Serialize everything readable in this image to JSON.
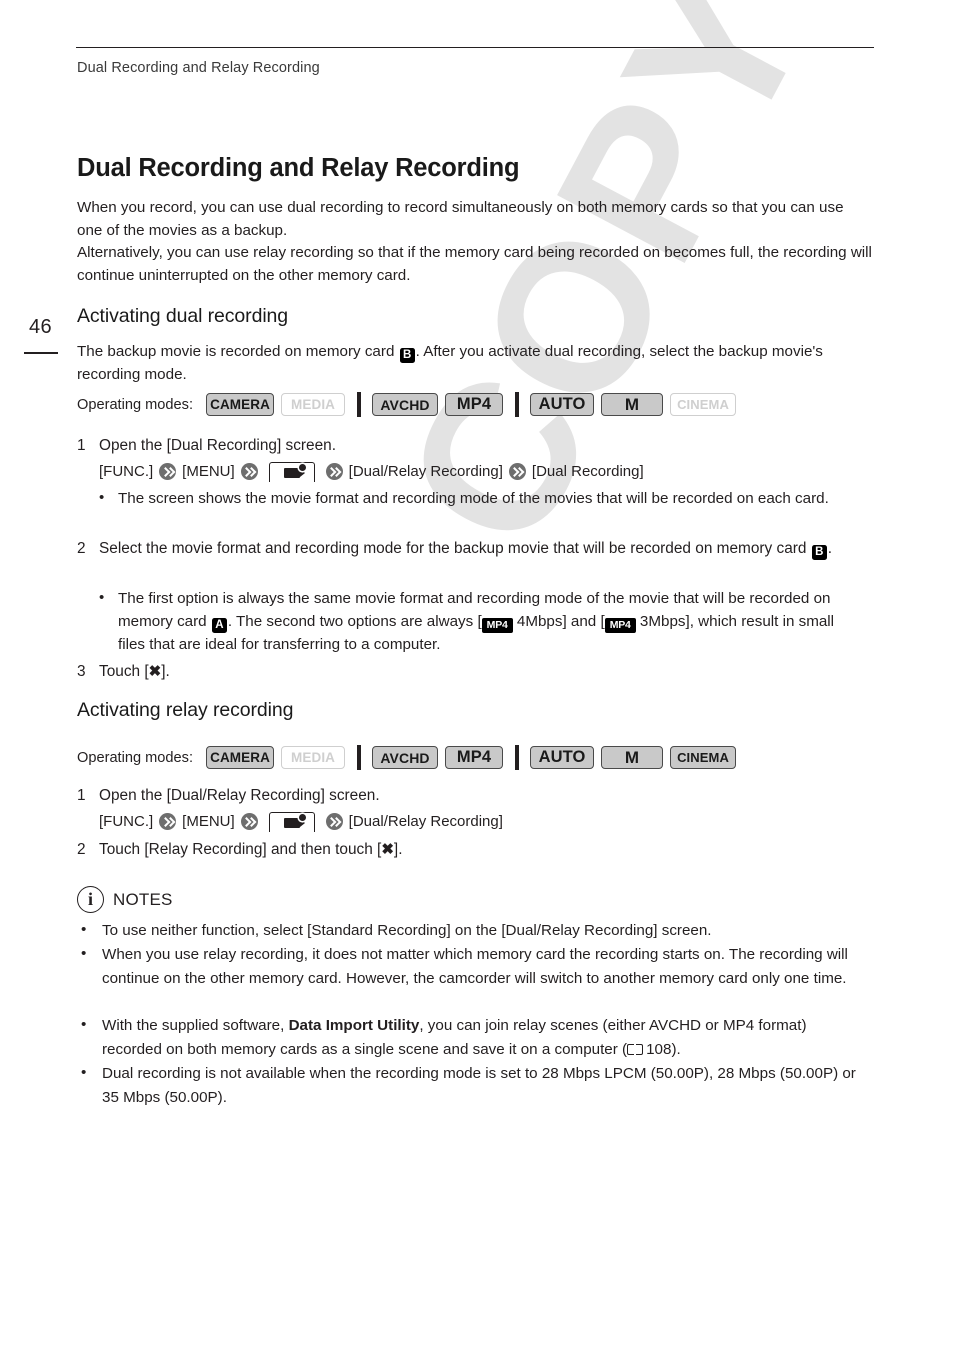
{
  "page": {
    "folio": "46",
    "running_head": "Dual Recording and Relay Recording"
  },
  "watermark": "COPY",
  "title": "Dual Recording and Relay Recording",
  "intro": "When you record, you can use dual recording to record simultaneously on both memory cards so that you can use one of the movies as a backup.\nAlternatively, you can use relay recording so that if the memory card being recorded on becomes full, the recording will continue uninterrupted on the other memory card.",
  "sections": [
    {
      "heading": "Activating dual recording",
      "intro_a": "The backup movie is recorded on memory card ",
      "intro_card": "B",
      "intro_b": ". After you activate dual recording, select the backup movie's recording mode.",
      "opmodes_label": "Operating modes:",
      "steps": {
        "s1_num": "1",
        "s1_text": "Open the [Dual Recording] screen.",
        "s1_path_1": "[FUNC.]",
        "s1_path_2": "[MENU]",
        "s1_path_3": "[Dual/Relay Recording]",
        "s1_path_4": "[Dual Recording]",
        "s1_bullet": "The screen shows the movie format and recording mode of the movies that will be recorded on each card.",
        "s2_num": "2",
        "s2_text_a": "Select the movie format and recording mode for the backup movie that will be recorded on memory card ",
        "s2_card": "B",
        "s2_text_b": ".",
        "s2_bullet_a": "The first option is always the same movie format and recording mode of the movie that will be recorded on memory card ",
        "s2_bullet_card": "A",
        "s2_bullet_b": ". The second two options are always [",
        "s2_badge_1": "MP4",
        "s2_bullet_c": " 4Mbps] and [",
        "s2_badge_2": "MP4",
        "s2_bullet_d": " 3Mbps], which result in small files that are ideal for transferring to a computer.",
        "s3_num": "3",
        "s3_text_a": "Touch [",
        "s3_x": "✖",
        "s3_text_b": "]."
      }
    },
    {
      "heading": "Activating relay recording",
      "opmodes_label": "Operating modes:",
      "steps": {
        "s1_num": "1",
        "s1_text": "Open the [Dual/Relay Recording] screen.",
        "s1_path_1": "[FUNC.]",
        "s1_path_2": "[MENU]",
        "s1_path_3": "[Dual/Relay Recording]",
        "s2_num": "2",
        "s2_text_a": "Touch [Relay Recording] and then touch [",
        "s2_x": "✖",
        "s2_text_b": "]."
      }
    }
  ],
  "opmodes_badges_dual": [
    {
      "label": "CAMERA",
      "state": "on"
    },
    {
      "label": "MEDIA",
      "state": "off"
    },
    {
      "label": "AVCHD",
      "state": "on"
    },
    {
      "label": "MP4",
      "state": "on"
    },
    {
      "label": "AUTO",
      "state": "on"
    },
    {
      "label": "M",
      "state": "on"
    },
    {
      "label": "CINEMA",
      "state": "off"
    }
  ],
  "opmodes_badges_relay": [
    {
      "label": "CAMERA",
      "state": "on"
    },
    {
      "label": "MEDIA",
      "state": "off"
    },
    {
      "label": "AVCHD",
      "state": "on"
    },
    {
      "label": "MP4",
      "state": "on"
    },
    {
      "label": "AUTO",
      "state": "on"
    },
    {
      "label": "M",
      "state": "on"
    },
    {
      "label": "CINEMA",
      "state": "on"
    }
  ],
  "notes": {
    "icon_letter": "i",
    "title": "NOTES",
    "bullet_char": "•",
    "items": [
      {
        "text": "To use neither function, select [Standard Recording] on the [Dual/Relay Recording] screen."
      },
      {
        "text": "When you use relay recording, it does not matter which memory card the recording starts on. The recording will continue on the other memory card. However, the camcorder will switch to another memory card only one time."
      },
      {
        "text_a": "With the supplied software, ",
        "bold": "Data Import Utility",
        "text_b": ", you can join relay scenes (either AVCHD or MP4 format) recorded on both memory cards as a single scene and save it on a computer (",
        "page_ref": "108",
        "text_c": ")."
      },
      {
        "text": "Dual recording is not available when the recording mode is set to 28 Mbps LPCM (50.00P), 28 Mbps (50.00P) or 35 Mbps (50.00P)."
      }
    ]
  },
  "colors": {
    "text": "#231f20",
    "badge_on_bg": "#c9c9c9",
    "badge_on_border": "#4a4a4a",
    "badge_off_border": "#cfcfcf",
    "watermark": "#e3e3e3",
    "arrow": "#6e6e6e"
  }
}
